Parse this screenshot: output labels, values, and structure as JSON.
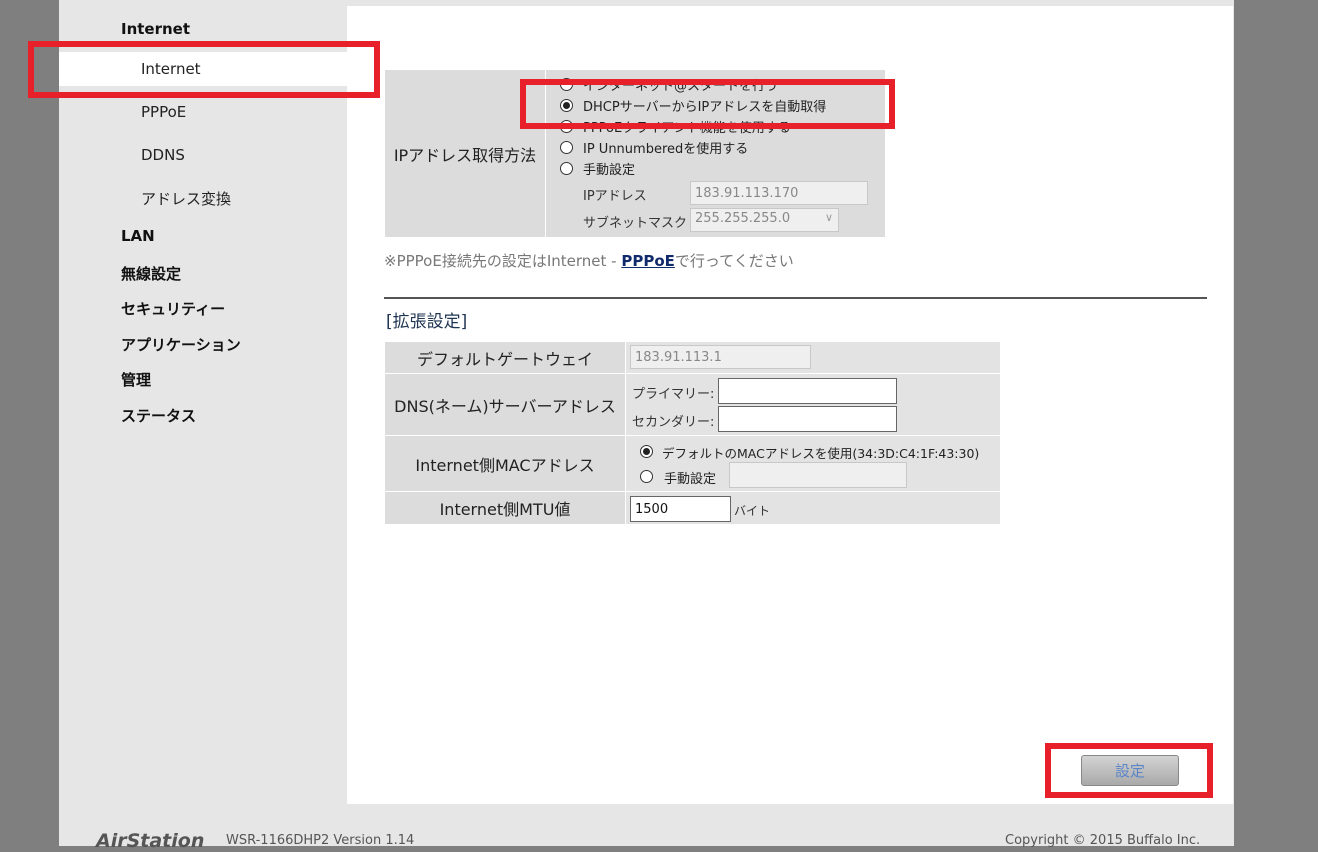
{
  "sidebar": {
    "internet_group": "Internet",
    "items": [
      "Internet",
      "PPPoE",
      "DDNS",
      "アドレス変換"
    ],
    "groups": [
      "LAN",
      "無線設定",
      "セキュリティー",
      "アプリケーション",
      "管理",
      "ステータス"
    ]
  },
  "ip_method": {
    "label": "IPアドレス取得方法",
    "options": [
      "インターネット@スタートを行う",
      "DHCPサーバーからIPアドレスを自動取得",
      "PPPoEクライアント機能を使用する",
      "IP Unnumberedを使用する",
      "手動設定"
    ],
    "selected_index": 1,
    "ip_address_label": "IPアドレス",
    "ip_address_value": "183.91.113.170",
    "subnet_label": "サブネットマスク",
    "subnet_value": "255.255.255.0"
  },
  "note": {
    "prefix": "※PPPoE接続先の設定はInternet - ",
    "link": "PPPoE",
    "suffix": "で行ってください"
  },
  "advanced": {
    "title": "[拡張設定]",
    "gateway_label": "デフォルトゲートウェイ",
    "gateway_value": "183.91.113.1",
    "dns_label": "DNS(ネーム)サーバーアドレス",
    "dns_primary_label": "プライマリー:",
    "dns_secondary_label": "セカンダリー:",
    "dns_primary_value": "",
    "dns_secondary_value": "",
    "mac_label": "Internet側MACアドレス",
    "mac_default_option": "デフォルトのMACアドレスを使用(34:3D:C4:1F:43:30)",
    "mac_manual_option": "手動設定",
    "mac_manual_value": "",
    "mtu_label": "Internet側MTU値",
    "mtu_value": "1500",
    "mtu_unit": "バイト"
  },
  "submit_label": "設定",
  "footer": {
    "logo": "AirStation",
    "model": "WSR-1166DHP2 Version 1.14",
    "copyright": "Copyright © 2015 Buffalo Inc."
  },
  "colors": {
    "highlight": "#e8202a",
    "link": "#112a6b",
    "button_text": "#5a86c8"
  }
}
